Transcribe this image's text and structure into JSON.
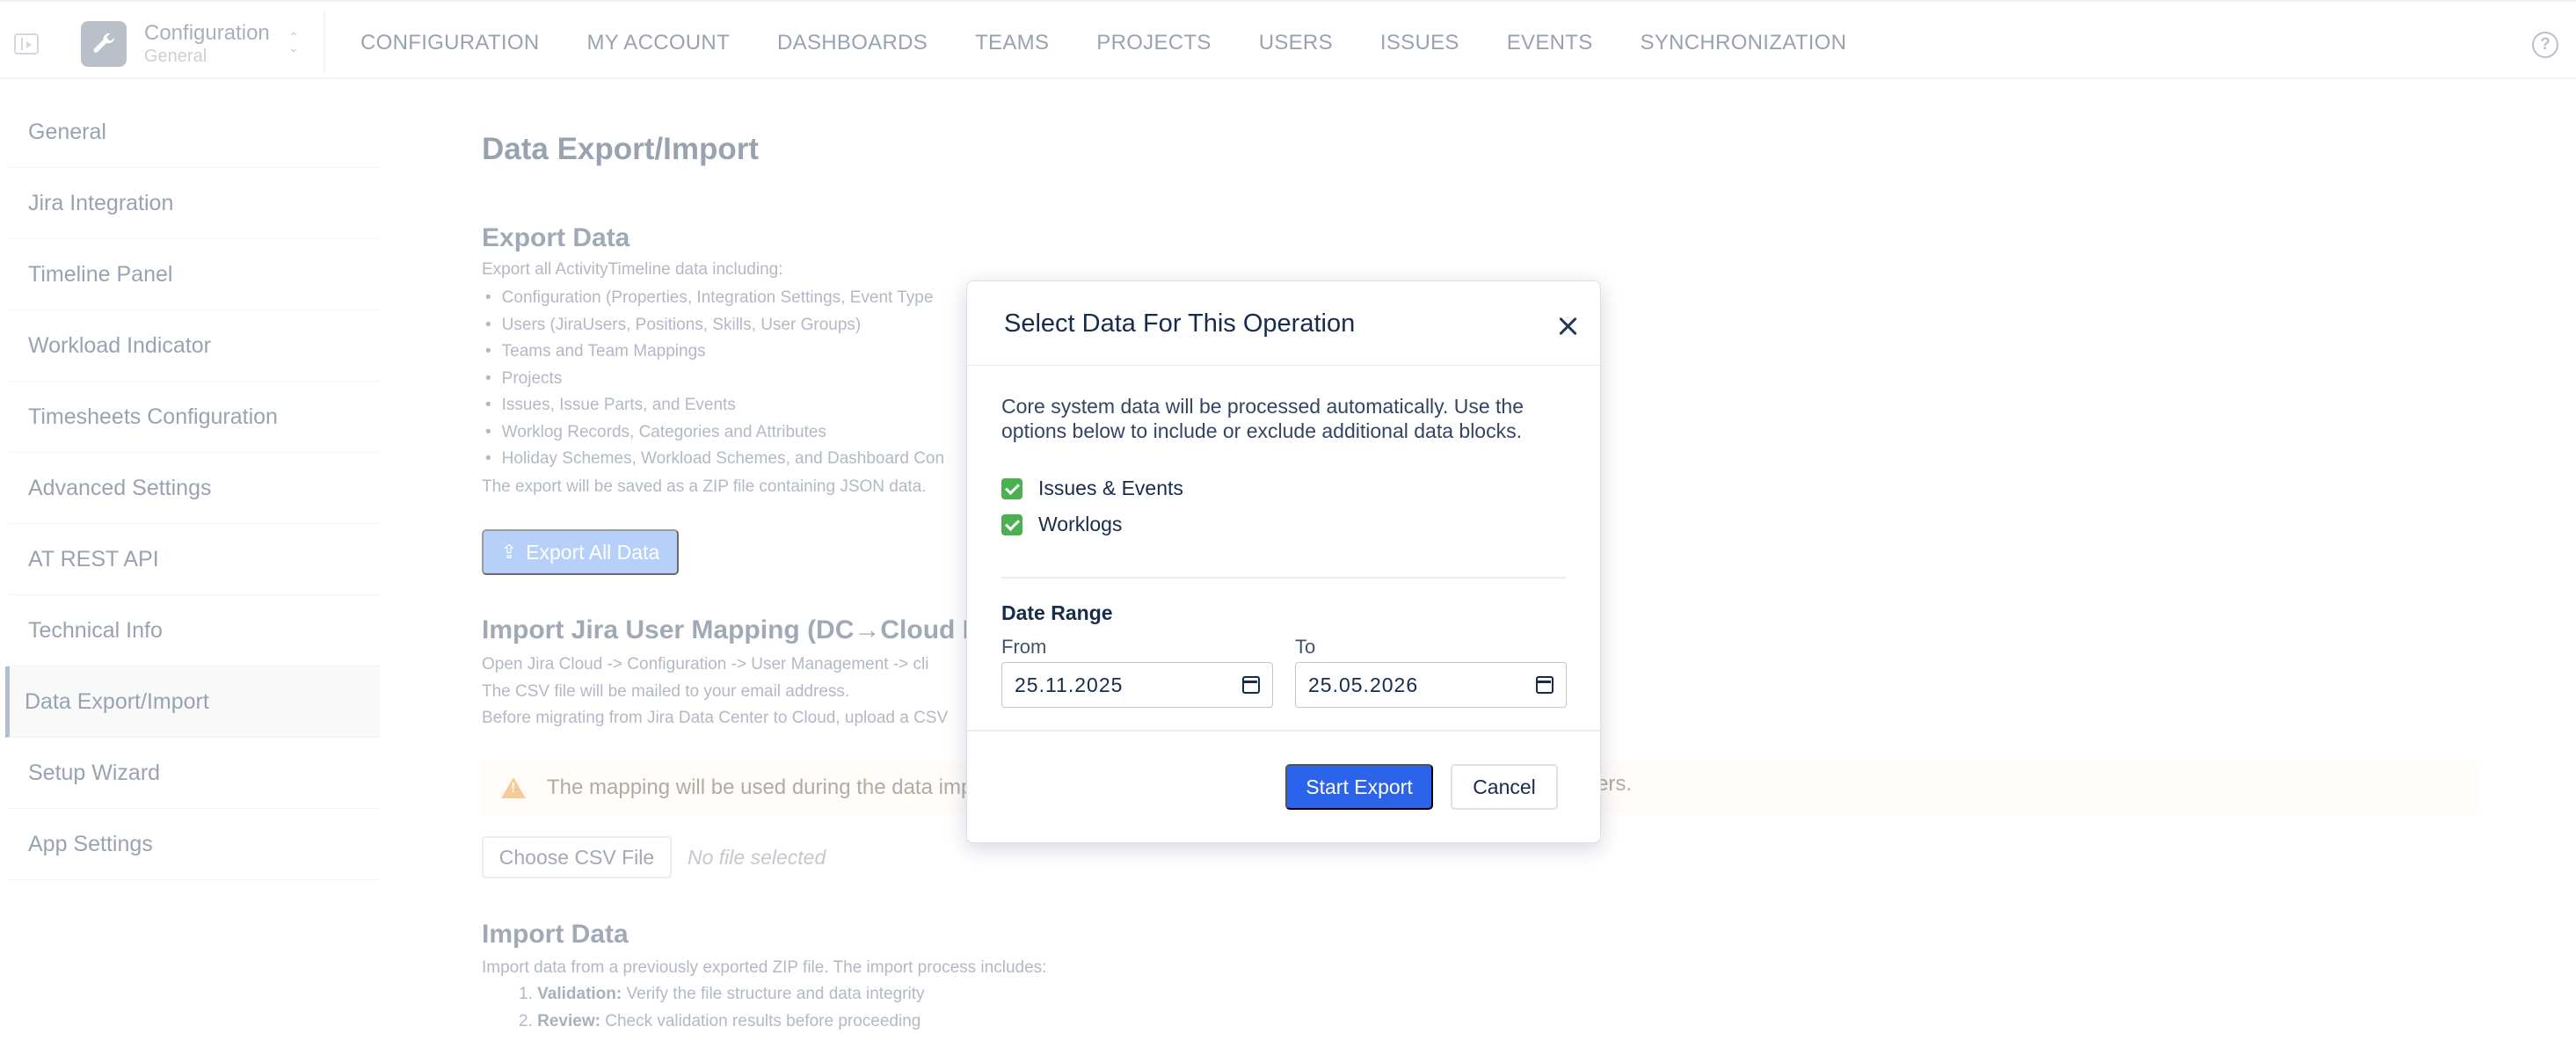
{
  "header": {
    "app_title": "Configuration",
    "app_subtitle": "General",
    "nav": [
      "CONFIGURATION",
      "MY ACCOUNT",
      "DASHBOARDS",
      "TEAMS",
      "PROJECTS",
      "USERS",
      "ISSUES",
      "EVENTS",
      "SYNCHRONIZATION"
    ]
  },
  "sidebar": {
    "items": [
      {
        "label": "General"
      },
      {
        "label": "Jira Integration"
      },
      {
        "label": "Timeline Panel"
      },
      {
        "label": "Workload Indicator"
      },
      {
        "label": "Timesheets Configuration"
      },
      {
        "label": "Advanced Settings"
      },
      {
        "label": "AT REST API"
      },
      {
        "label": "Technical Info"
      },
      {
        "label": "Data Export/Import",
        "active": true
      },
      {
        "label": "Setup Wizard"
      },
      {
        "label": "App Settings"
      }
    ]
  },
  "main": {
    "page_title": "Data Export/Import",
    "export": {
      "title": "Export Data",
      "intro": "Export all ActivityTimeline data including:",
      "bullets": [
        "Configuration (Properties, Integration Settings, Event Type",
        "Users (JiraUsers, Positions, Skills, User Groups)",
        "Teams and Team Mappings",
        "Projects",
        "Issues, Issue Parts, and Events",
        "Worklog Records, Categories and Attributes",
        "Holiday Schemes, Workload Schemes, and Dashboard Con"
      ],
      "note": "The export will be saved as a ZIP file containing JSON data.",
      "button": "Export All Data"
    },
    "mapping": {
      "title": "Import Jira User Mapping (DC→Cloud Mi",
      "lines": [
        "Open Jira Cloud -> Configuration -> User Management -> cli",
        "The CSV file will be mailed to your email address.",
        "Before migrating from Jira Data Center to Cloud, upload a CSV"
      ],
      "warning": "The mapping will be used during the data imp",
      "warning_tail": "ers.",
      "choose_button": "Choose CSV File",
      "no_file": "No file selected"
    },
    "import": {
      "title": "Import Data",
      "intro": "Import data from a previously exported ZIP file. The import process includes:",
      "steps": [
        {
          "num": "1.",
          "bold": "Validation:",
          "text": "Verify the file structure and data integrity"
        },
        {
          "num": "2.",
          "bold": "Review:",
          "text": "Check validation results before proceeding"
        }
      ]
    }
  },
  "modal": {
    "title": "Select Data For This Operation",
    "description": "Core system data will be processed automatically. Use the options below to include or exclude additional data blocks.",
    "options": [
      {
        "label": "Issues & Events",
        "checked": true
      },
      {
        "label": "Worklogs",
        "checked": true
      }
    ],
    "date_range_label": "Date Range",
    "from_label": "From",
    "from_value": "25.11.2025",
    "to_label": "To",
    "to_value": "25.05.2026",
    "start_button": "Start Export",
    "cancel_button": "Cancel"
  },
  "colors": {
    "primary": "#2b63ea",
    "export_button_disabled": "#82aef6",
    "checkbox": "#4caf50",
    "warning": "#f2a64f"
  },
  "icons": [
    "sidebar-collapse-icon",
    "wrench-icon",
    "chevron-updown-icon",
    "help-icon",
    "upload-icon",
    "warning-icon",
    "close-icon",
    "checkbox-checked-icon",
    "calendar-icon"
  ]
}
